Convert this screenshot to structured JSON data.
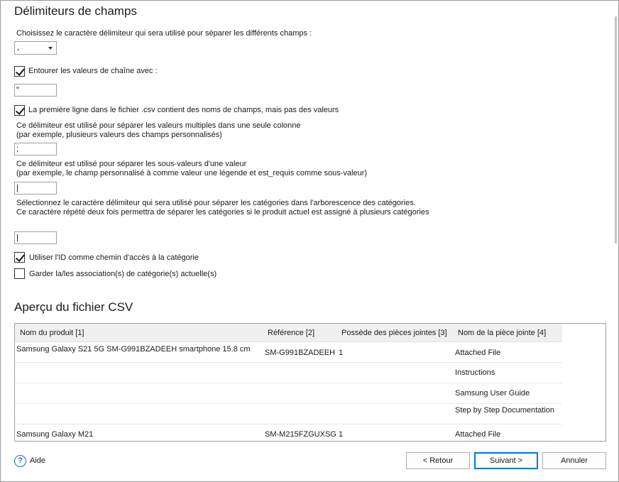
{
  "delimiters": {
    "title": "Délimiteurs de champs",
    "choose_label": "Choisissez le caractère délimiteur qui sera utilisé pour séparer les différents champs :",
    "delimiter_value": ",",
    "enclose_label": "Entourer les valeurs de chaîne avec :",
    "enclose_checked": true,
    "enclose_value": "\"",
    "first_line_label": "La première ligne dans le fichier .csv contient des noms de champs, mais pas des valeurs",
    "first_line_checked": true,
    "multi_label_1": "Ce délimiteur est utilisé pour séparer les valeurs multiples dans une seule colonne",
    "multi_label_2": "(par exemple, plusieurs valeurs des champs personnalisés)",
    "multi_value": ";",
    "sub_label_1": "Ce délimiteur est utilisé pour séparer les sous-valeurs d'une valeur",
    "sub_label_2": "(par exemple, le champ personnalisé à comme valeur une légende et est_requis comme sous-valeur)",
    "sub_value": "|",
    "cat_label_1": "Sélectionnez le caractère délimiteur qui sera utilisé pour séparer les catégories dans l'arborescence des catégories.",
    "cat_label_2": "Ce caractère répété deux fois permettra de séparer les catégories si le produit actuel est assigné à plusieurs catégories",
    "cat_value": "|",
    "use_id_label": "Utiliser l'ID comme chemin d'accès à la catégorie",
    "use_id_checked": true,
    "keep_label": "Garder la/les association(s) de catégorie(s) actuelle(s)",
    "keep_checked": false
  },
  "preview": {
    "title": "Aperçu du fichier CSV",
    "columns": [
      "Nom du produit [1]",
      "Référence [2]",
      "Possède des pièces jointes [3]",
      "Nom de la pièce jointe [4]"
    ],
    "rows": [
      [
        "Samsung Galaxy S21 5G SM-G991BZADEEH smartphone 15.8 cm",
        "SM-G991BZADEEH",
        "1",
        "Attached File"
      ],
      [
        "",
        "",
        "",
        "Instructions"
      ],
      [
        "",
        "",
        "",
        "Samsung User Guide"
      ],
      [
        "",
        "",
        "",
        "Step by Step Documentation"
      ],
      [
        "Samsung Galaxy M21",
        "SM-M215FZGUXSG",
        "1",
        "Attached File"
      ]
    ]
  },
  "footer": {
    "help": "Aide",
    "back": "< Retour",
    "next": "Suivant >",
    "cancel": "Annuler"
  }
}
